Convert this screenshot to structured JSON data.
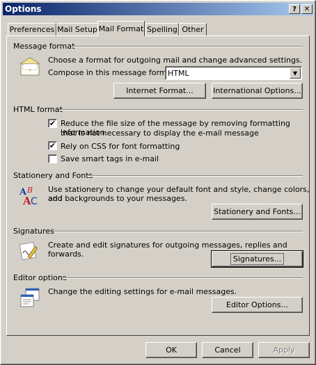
{
  "window": {
    "title": "Options"
  },
  "titlebar": {
    "help": "?",
    "close": "✕"
  },
  "tabs": [
    {
      "label": "Preferences"
    },
    {
      "label": "Mail Setup"
    },
    {
      "label": "Mail Format",
      "active": true
    },
    {
      "label": "Spelling"
    },
    {
      "label": "Other"
    }
  ],
  "message_format": {
    "title": "Message format",
    "desc": "Choose a format for outgoing mail and change advanced settings.",
    "compose_label": "Compose in this message format:",
    "compose_value": "HTML",
    "internet_button": "Internet Format...",
    "international_button": "International Options..."
  },
  "html_format": {
    "title": "HTML format",
    "opt1_line1": "Reduce the file size of the message by removing formatting information",
    "opt1_line2": "that is not necessary to display the e-mail message",
    "opt1_checked": true,
    "opt2": "Rely on CSS for font formatting",
    "opt2_checked": true,
    "opt3": "Save smart tags in e-mail",
    "opt3_checked": false
  },
  "stationery": {
    "title": "Stationery and Fonts",
    "desc_line1": "Use stationery to change your default font and style, change colors, and",
    "desc_line2": "add backgrounds to your messages.",
    "button": "Stationery and Fonts..."
  },
  "signatures": {
    "title": "Signatures",
    "desc": "Create and edit signatures for outgoing messages, replies and forwards.",
    "button": "Signatures..."
  },
  "editor": {
    "title": "Editor options",
    "desc": "Change the editing settings for e-mail messages.",
    "button": "Editor Options..."
  },
  "footer": {
    "ok": "OK",
    "cancel": "Cancel",
    "apply": "Apply"
  }
}
